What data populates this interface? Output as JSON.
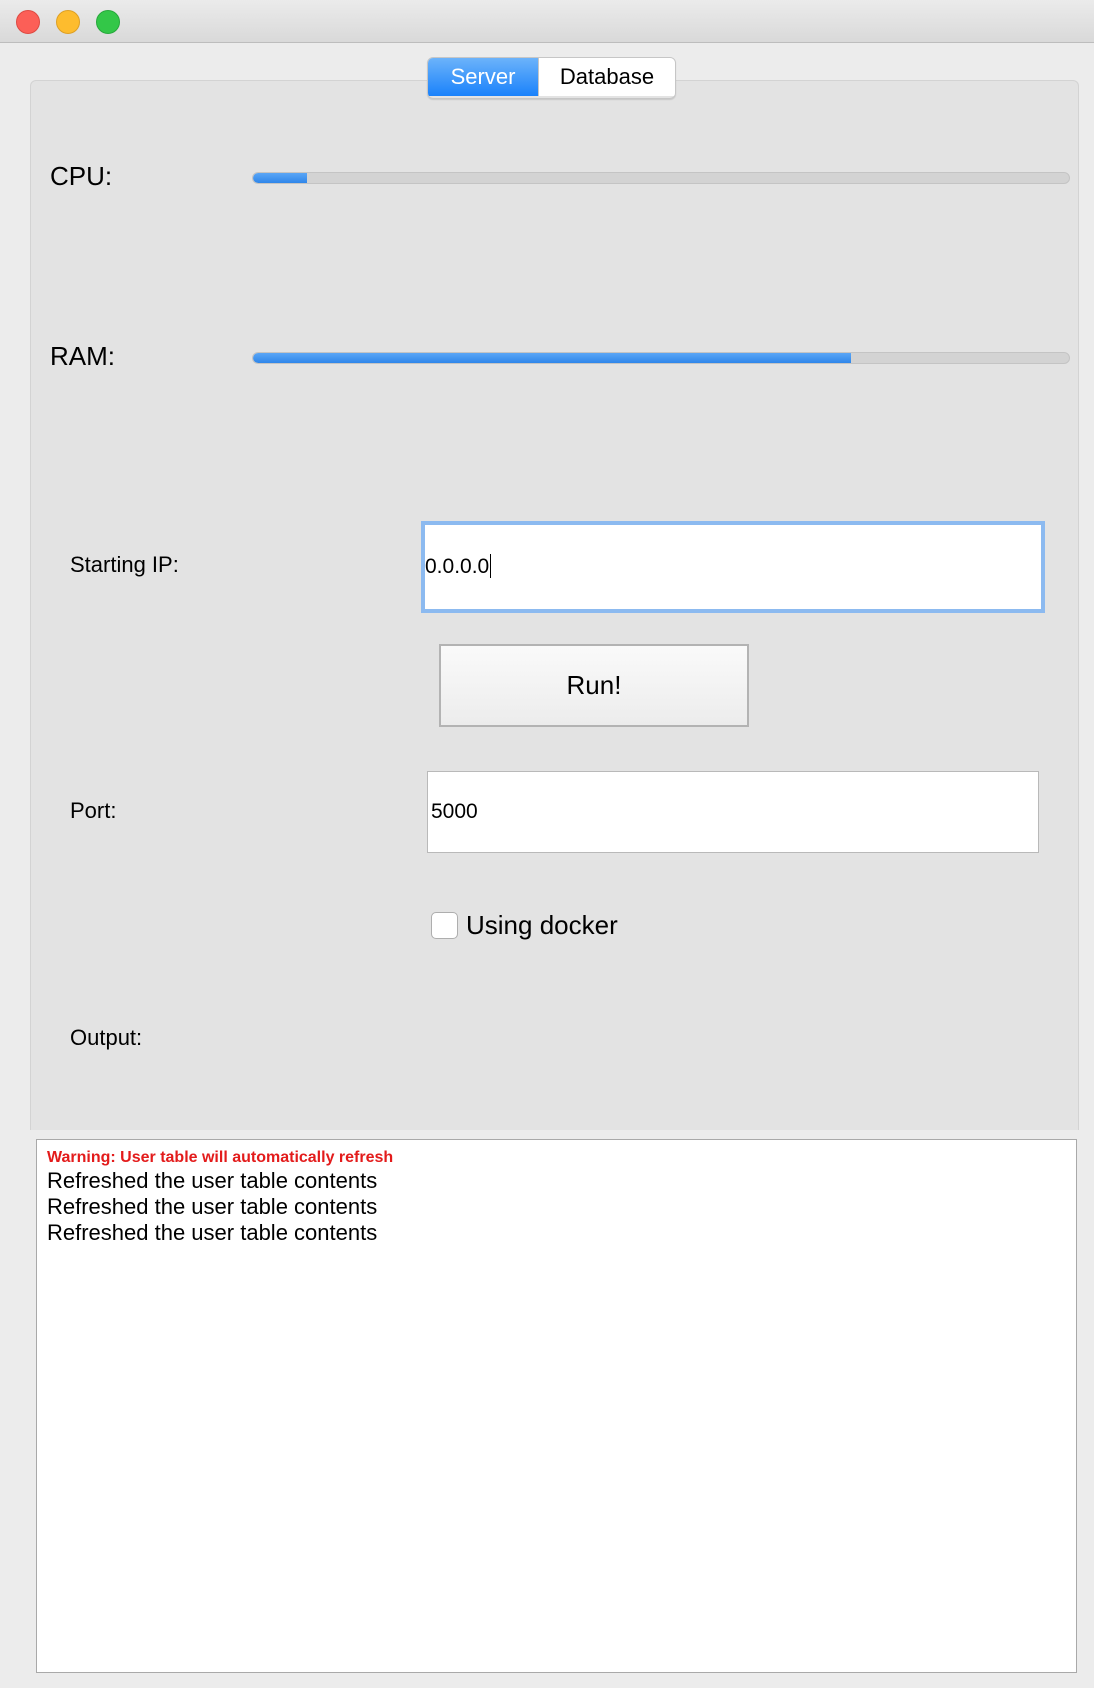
{
  "tabs": [
    {
      "label": "Server",
      "active": true
    },
    {
      "label": "Database",
      "active": false
    }
  ],
  "cpu": {
    "label": "CPU:",
    "usage_fraction": 0.066
  },
  "ram": {
    "label": "RAM:",
    "usage_fraction": 0.733
  },
  "starting_ip": {
    "label": "Starting IP:",
    "value": "0.0.0.0"
  },
  "run_button": {
    "label": "Run!"
  },
  "port": {
    "label": "Port:",
    "value": "5000"
  },
  "docker": {
    "label": "Using docker",
    "checked": false
  },
  "output": {
    "label": "Output:",
    "warning": "Warning: User table will automatically refresh",
    "lines": [
      "Refreshed the user table contents",
      "Refreshed the user table contents",
      "Refreshed the user table contents"
    ]
  },
  "colors": {
    "accent": "#1a82fb",
    "progress_fill": "#3d8ff0",
    "warning": "#e31b1b",
    "focus_ring": "#8cbaf0"
  }
}
